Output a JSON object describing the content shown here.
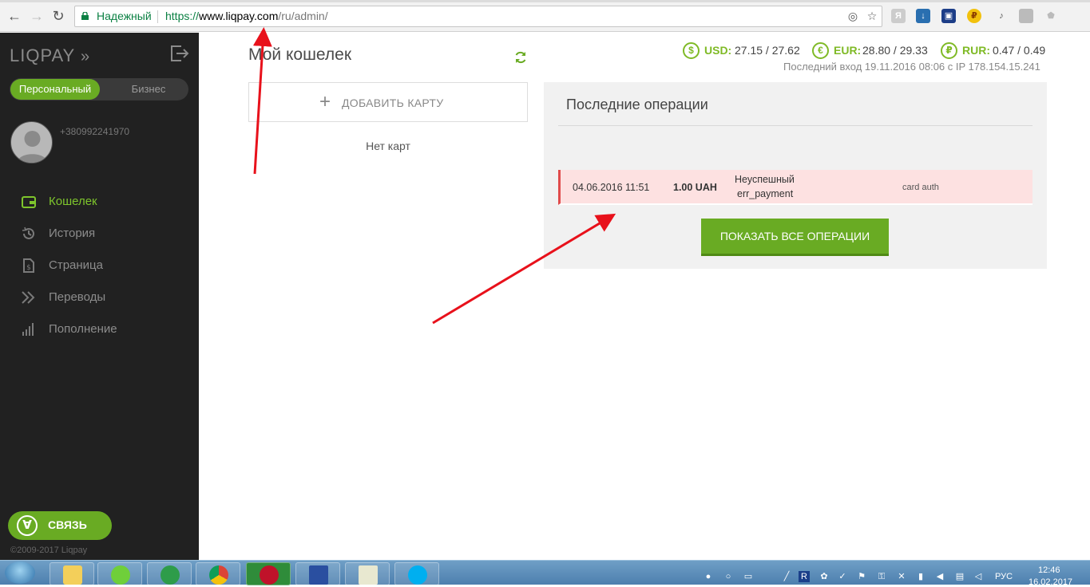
{
  "browser": {
    "secure_label": "Надежный",
    "url_scheme": "https://",
    "url_host": "www.liqpay.com",
    "url_path": "/ru/admin/"
  },
  "sidebar": {
    "logo": "LIQPAY",
    "account_toggle": {
      "personal": "Персональный",
      "business": "Бизнес"
    },
    "phone": "+380992241970",
    "menu": [
      {
        "label": "Кошелек",
        "icon": "wallet-icon"
      },
      {
        "label": "История",
        "icon": "history-icon"
      },
      {
        "label": "Страница",
        "icon": "page-icon"
      },
      {
        "label": "Переводы",
        "icon": "transfers-icon"
      },
      {
        "label": "Пополнение",
        "icon": "topup-icon"
      }
    ],
    "contact_button": "СВЯЗЬ",
    "copyright": "©2009-2017 Liqpay"
  },
  "main": {
    "title": "Мой кошелек",
    "add_card": "ДОБАВИТЬ КАРТУ",
    "no_cards": "Нет карт",
    "rates": [
      {
        "symbol": "$",
        "code": "USD:",
        "value": "27.15 / 27.62"
      },
      {
        "symbol": "€",
        "code": "EUR:",
        "value": "28.80 / 29.33"
      },
      {
        "symbol": "₽",
        "code": "RUR:",
        "value": "0.47 / 0.49"
      }
    ],
    "last_login": "Последний вход 19.11.2016 08:06 с IP 178.154.15.241",
    "operations": {
      "title": "Последние операции",
      "rows": [
        {
          "date": "04.06.2016 11:51",
          "amount": "1.00 UAH",
          "status": "Неуспешный",
          "error": "err_payment",
          "description": "card auth"
        }
      ],
      "show_all": "ПОКАЗАТЬ ВСЕ ОПЕРАЦИИ"
    }
  },
  "taskbar": {
    "lang": "РУС",
    "time": "12:46",
    "date": "16.02.2017"
  },
  "colors": {
    "accent_green": "#69ab23",
    "sidebar_bg": "#212121",
    "error_row_bg": "#fde1e1",
    "annotation_red": "#e8111b"
  }
}
